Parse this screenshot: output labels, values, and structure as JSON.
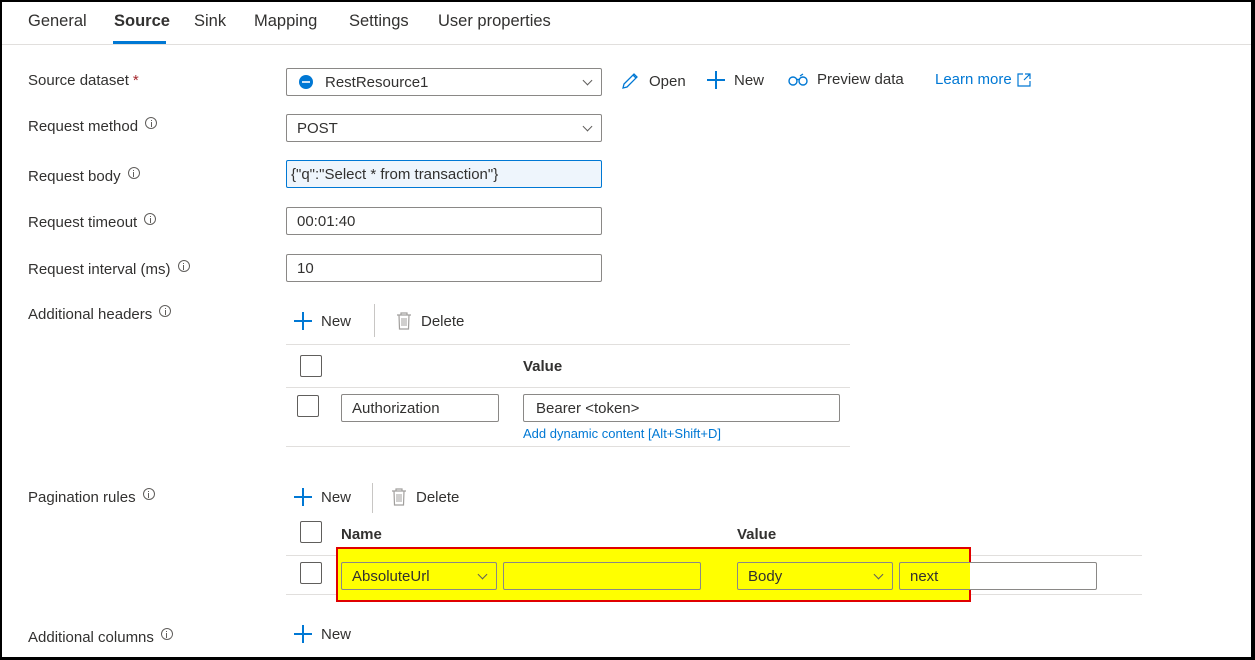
{
  "tabs": [
    {
      "label": "General",
      "active": false
    },
    {
      "label": "Source",
      "active": true
    },
    {
      "label": "Sink",
      "active": false
    },
    {
      "label": "Mapping",
      "active": false
    },
    {
      "label": "Settings",
      "active": false
    },
    {
      "label": "User properties",
      "active": false
    }
  ],
  "accent_color": "#0078d4",
  "highlight_color": "#ffff00",
  "highlight_border_color": "#e00000",
  "source_dataset": {
    "label": "Source dataset",
    "required_mark": "*",
    "value": "RestResource1",
    "icon": "rest-dataset-icon",
    "actions": {
      "open": "Open",
      "new": "New",
      "preview": "Preview data",
      "learn_more": "Learn more"
    }
  },
  "request_method": {
    "label": "Request method",
    "value": "POST"
  },
  "request_body": {
    "label": "Request body",
    "value": "{\"q\":\"Select * from transaction\"}"
  },
  "request_timeout": {
    "label": "Request timeout",
    "value": "00:01:40"
  },
  "request_interval": {
    "label": "Request interval (ms)",
    "value": "10"
  },
  "additional_headers": {
    "label": "Additional headers",
    "new_label": "New",
    "delete_label": "Delete",
    "columns": {
      "name": "",
      "value": "Value"
    },
    "rows": [
      {
        "name": "Authorization",
        "value": "Bearer <token>",
        "dynamic_link": "Add dynamic content [Alt+Shift+D]"
      }
    ]
  },
  "pagination_rules": {
    "label": "Pagination rules",
    "new_label": "New",
    "delete_label": "Delete",
    "columns": {
      "name": "Name",
      "value": "Value"
    },
    "rows": [
      {
        "name_type": "AbsoluteUrl",
        "name_value": "",
        "value_type": "Body",
        "value_value": "next"
      }
    ]
  },
  "additional_columns": {
    "label": "Additional columns",
    "new_label": "New"
  }
}
